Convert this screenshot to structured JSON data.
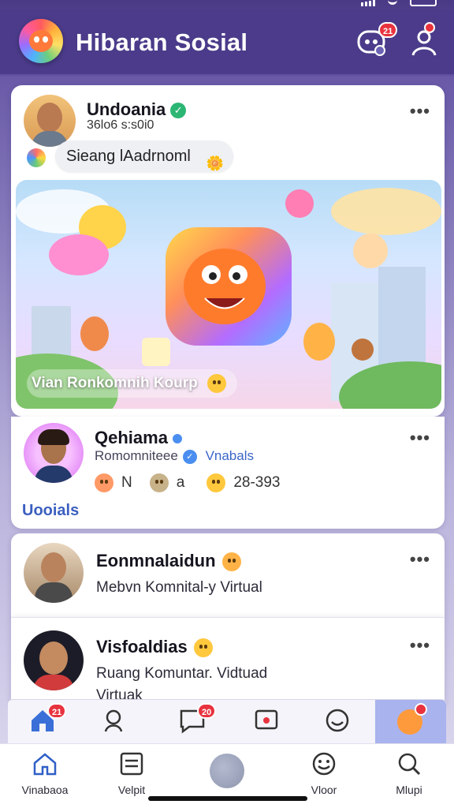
{
  "header": {
    "title": "Hibaran Sosial",
    "notif_badge": "21",
    "profile_badge": ""
  },
  "feed": {
    "post1": {
      "author": "Undoania",
      "meta": "36lo6 s:s0i0",
      "pill_text": "Sieang lAadrnoml",
      "image_caption": "Vian Ronkomnih Kourp"
    },
    "post2": {
      "author": "Qehiama",
      "group": "Romomniteee",
      "group_tag": "Vnabals",
      "stats": [
        {
          "label": "N"
        },
        {
          "label": "a"
        },
        {
          "label": "28-393"
        }
      ],
      "footer_link": "Uooials"
    },
    "post3": {
      "author": "Eonmnalaidun",
      "subtitle": "Mebvn Komnital-y Virtual"
    },
    "post4": {
      "author": "Visfoaldias",
      "subtitle": "Ruang Komuntar. Vidtuad",
      "subtitle2": "Virtuak"
    }
  },
  "tabs": {
    "badges": {
      "home": "21",
      "chat": "20"
    }
  },
  "bottom_nav": {
    "items": [
      {
        "label": "Vinabaoa",
        "icon": "home-icon"
      },
      {
        "label": "Velpit",
        "icon": "news-icon"
      },
      {
        "label": "",
        "icon": "center-button"
      },
      {
        "label": "Vloor",
        "icon": "smile-icon"
      },
      {
        "label": "Mlupi",
        "icon": "search-icon"
      }
    ]
  },
  "colors": {
    "appbar": "#4b3b8a",
    "accent": "#4a6fd0",
    "badge": "#e8333e",
    "verified": "#2bb673"
  }
}
